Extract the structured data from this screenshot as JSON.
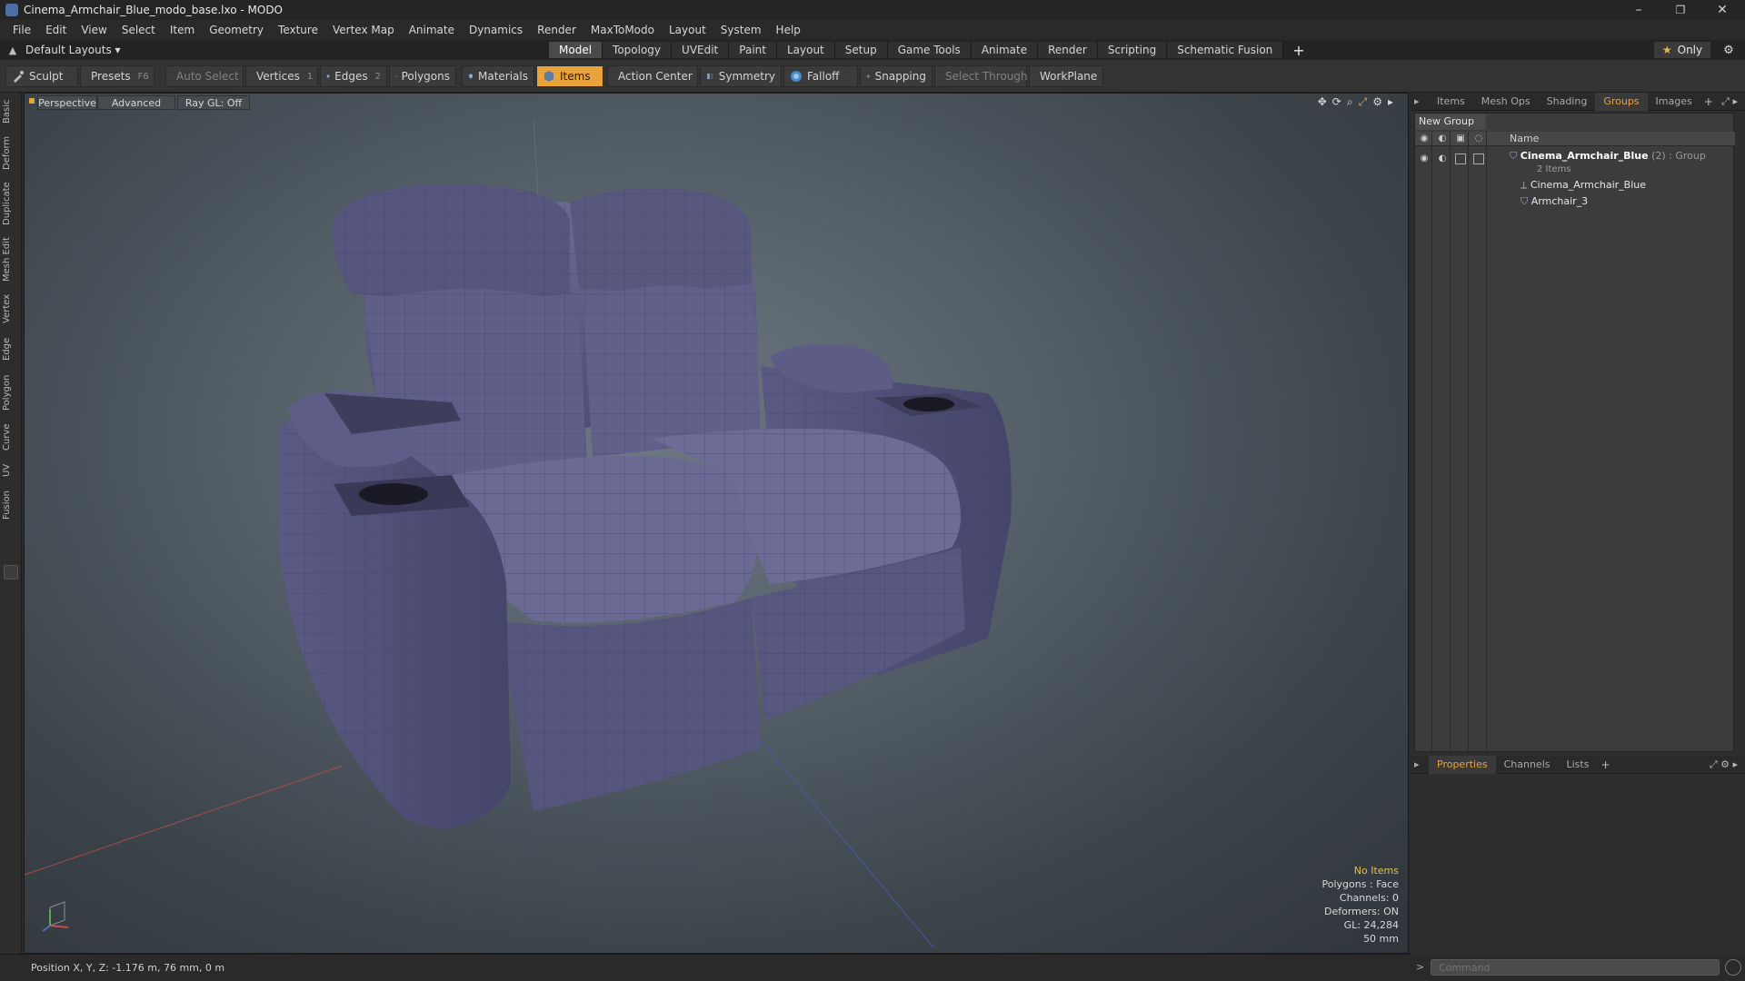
{
  "window": {
    "title": "Cinema_Armchair_Blue_modo_base.lxo - MODO",
    "minimize": "–",
    "restore": "❐",
    "close": "✕"
  },
  "menu": [
    "File",
    "Edit",
    "View",
    "Select",
    "Item",
    "Geometry",
    "Texture",
    "Vertex Map",
    "Animate",
    "Dynamics",
    "Render",
    "MaxToModo",
    "Layout",
    "System",
    "Help"
  ],
  "layout": {
    "selector": "Default Layouts ▾",
    "tabs": [
      "Model",
      "Topology",
      "UVEdit",
      "Paint",
      "Layout",
      "Setup",
      "Game Tools",
      "Animate",
      "Render",
      "Scripting",
      "Schematic Fusion"
    ],
    "active_tab": "Model",
    "plus": "+",
    "only_label": "Only"
  },
  "toolbar": {
    "sculpt": "Sculpt",
    "presets": "Presets",
    "presets_key": "F6",
    "auto_select": "Auto Select",
    "vertices": "Vertices",
    "vertices_key": "1",
    "edges": "Edges",
    "edges_key": "2",
    "polygons": "Polygons",
    "materials": "Materials",
    "items": "Items",
    "action_center": "Action Center",
    "symmetry": "Symmetry",
    "falloff": "Falloff",
    "snapping": "Snapping",
    "select_through": "Select Through",
    "workplane": "WorkPlane"
  },
  "left_tabs": [
    "Basic",
    "Deform",
    "Duplicate",
    "Mesh Edit",
    "Vertex",
    "Edge",
    "Polygon",
    "Curve",
    "UV",
    "Fusion"
  ],
  "viewport": {
    "view_mode": "Perspective",
    "shading": "Advanced",
    "raygl": "Ray GL: Off",
    "info": {
      "selection": "No Items",
      "polygons": "Polygons : Face",
      "channels": "Channels: 0",
      "deformers": "Deformers: ON",
      "gl": "GL: 24,284",
      "scale": "50 mm"
    }
  },
  "right_panel": {
    "top_tabs": [
      "Items",
      "Mesh Ops",
      "Shading",
      "Groups",
      "Images"
    ],
    "active_top_tab": "Groups",
    "new_group": "New Group",
    "column_name": "Name",
    "group": {
      "name": "Cinema_Armchair_Blue",
      "meta": " (2) : Group",
      "count": "2 Items",
      "children": [
        "Cinema_Armchair_Blue",
        "Armchair_3"
      ]
    },
    "bottom_tabs": [
      "Properties",
      "Channels",
      "Lists"
    ],
    "active_bottom_tab": "Properties"
  },
  "status": {
    "position": "Position X, Y, Z:  -1.176 m, 76 mm, 0 m"
  },
  "command": {
    "placeholder": "Command"
  },
  "colors": {
    "accent": "#e8a33a",
    "chair": "#5a5a80"
  }
}
